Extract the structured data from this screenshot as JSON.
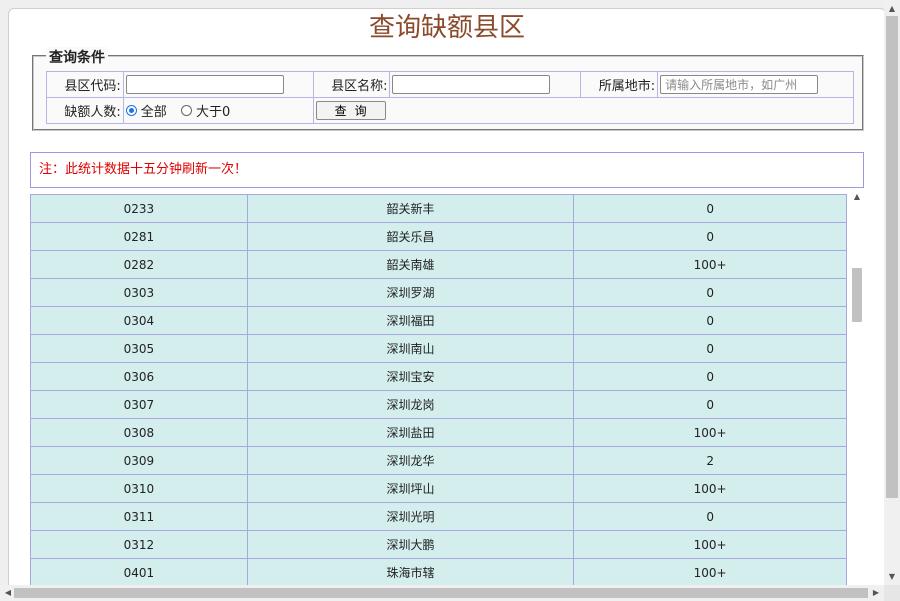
{
  "title": "查询缺额县区",
  "query": {
    "legend": "查询条件",
    "county_code_label": "县区代码:",
    "county_code_value": "",
    "county_name_label": "县区名称:",
    "county_name_value": "",
    "city_label": "所属地市:",
    "city_placeholder": "请输入所属地市，如广州",
    "vacancy_label": "缺额人数:",
    "radio_all": "全部",
    "radio_gt0": "大于0",
    "query_button": "查询"
  },
  "note": "注：此统计数据十五分钟刷新一次！",
  "rows": [
    {
      "code": "0233",
      "name": "韶关新丰",
      "count": "0"
    },
    {
      "code": "0281",
      "name": "韶关乐昌",
      "count": "0"
    },
    {
      "code": "0282",
      "name": "韶关南雄",
      "count": "100+"
    },
    {
      "code": "0303",
      "name": "深圳罗湖",
      "count": "0"
    },
    {
      "code": "0304",
      "name": "深圳福田",
      "count": "0"
    },
    {
      "code": "0305",
      "name": "深圳南山",
      "count": "0"
    },
    {
      "code": "0306",
      "name": "深圳宝安",
      "count": "0"
    },
    {
      "code": "0307",
      "name": "深圳龙岗",
      "count": "0"
    },
    {
      "code": "0308",
      "name": "深圳盐田",
      "count": "100+"
    },
    {
      "code": "0309",
      "name": "深圳龙华",
      "count": "2"
    },
    {
      "code": "0310",
      "name": "深圳坪山",
      "count": "100+"
    },
    {
      "code": "0311",
      "name": "深圳光明",
      "count": "0"
    },
    {
      "code": "0312",
      "name": "深圳大鹏",
      "count": "100+"
    },
    {
      "code": "0401",
      "name": "珠海市辖",
      "count": "100+"
    }
  ],
  "scroll_arrows": {
    "up": "▲",
    "down": "▼",
    "left": "◀",
    "right": "▶"
  }
}
